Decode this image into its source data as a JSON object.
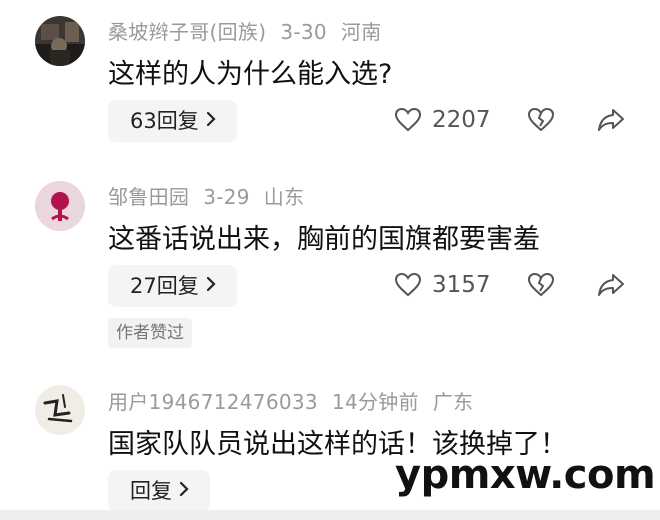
{
  "comments": [
    {
      "username": "桑坡辫子哥(回族)",
      "date": "3-30",
      "location": "河南",
      "text": "这样的人为什么能入选?",
      "replies_label": "63回复",
      "likes": "2207"
    },
    {
      "username": "邹鲁田园",
      "date": "3-29",
      "location": "山东",
      "text": "这番话说出来，胸前的国旗都要害羞",
      "replies_label": "27回复",
      "likes": "3157",
      "author_liked": "作者赞过"
    },
    {
      "username": "用户1946712476033",
      "date": "14分钟前",
      "location": "广东",
      "text": "国家队队员说出这样的话！该换掉了！",
      "replies_label": "回复"
    }
  ],
  "watermark": "ypmxw.com",
  "icons": [
    "heart-icon",
    "broken-heart-icon",
    "share-icon",
    "chevron-right-icon"
  ]
}
